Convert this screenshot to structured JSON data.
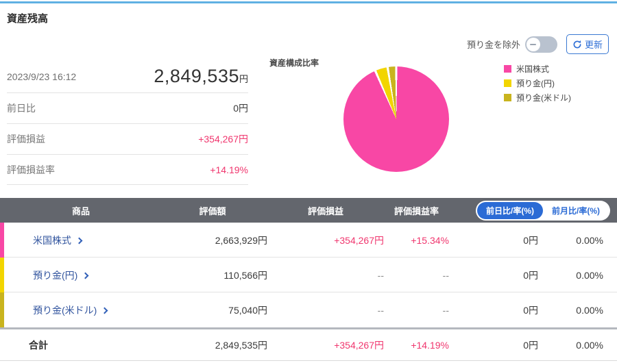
{
  "page": {
    "title": "資産残高"
  },
  "controls": {
    "toggle_label": "預り金を除外",
    "toggle_state": "off",
    "refresh_label": "更新"
  },
  "summary": {
    "timestamp": "2023/9/23 16:12",
    "total_value": "2,849,535",
    "total_unit": "円",
    "rows": [
      {
        "label": "前日比",
        "value": "0円"
      },
      {
        "label": "評価損益",
        "value": "+354,267円"
      },
      {
        "label": "評価損益率",
        "value": "+14.19%"
      }
    ]
  },
  "chart_data": {
    "type": "pie",
    "title": "資産構成比率",
    "labels": [
      "米国株式",
      "預り金(円)",
      "預り金(米ドル)"
    ],
    "values": [
      93.49,
      3.88,
      2.63
    ],
    "amounts_jpy": [
      2663929,
      110566,
      75040
    ],
    "colors": [
      "#f847a5",
      "#f2d500",
      "#c9b41e"
    ],
    "legend_position": "right",
    "start_angle": "top",
    "direction": "clockwise"
  },
  "table": {
    "headers": {
      "product": "商品",
      "valuation": "評価額",
      "pl": "評価損益",
      "pl_pct": "評価損益率"
    },
    "period_toggle": [
      {
        "label": "前日比/率(%)",
        "active": true
      },
      {
        "label": "前月比/率(%)",
        "active": false
      }
    ],
    "rows": [
      {
        "name": "米国株式",
        "valuation": "2,663,929円",
        "pl": "+354,267円",
        "pl_pct": "+15.34%",
        "day_change": "0円",
        "day_change_pct": "0.00%"
      },
      {
        "name": "預り金(円)",
        "valuation": "110,566円",
        "pl": "--",
        "pl_pct": "--",
        "day_change": "0円",
        "day_change_pct": "0.00%"
      },
      {
        "name": "預り金(米ドル)",
        "valuation": "75,040円",
        "pl": "--",
        "pl_pct": "--",
        "day_change": "0円",
        "day_change_pct": "0.00%"
      }
    ],
    "total_row": {
      "name": "合計",
      "valuation": "2,849,535円",
      "pl": "+354,267円",
      "pl_pct": "+14.19%",
      "day_change": "0円",
      "day_change_pct": "0.00%"
    }
  },
  "colors": {
    "accent_blue": "#2b6bd5",
    "link_blue": "#31549e",
    "positive_pink": "#f0366e",
    "topline_blue": "#5fb0e3",
    "header_gray": "#63666d"
  }
}
